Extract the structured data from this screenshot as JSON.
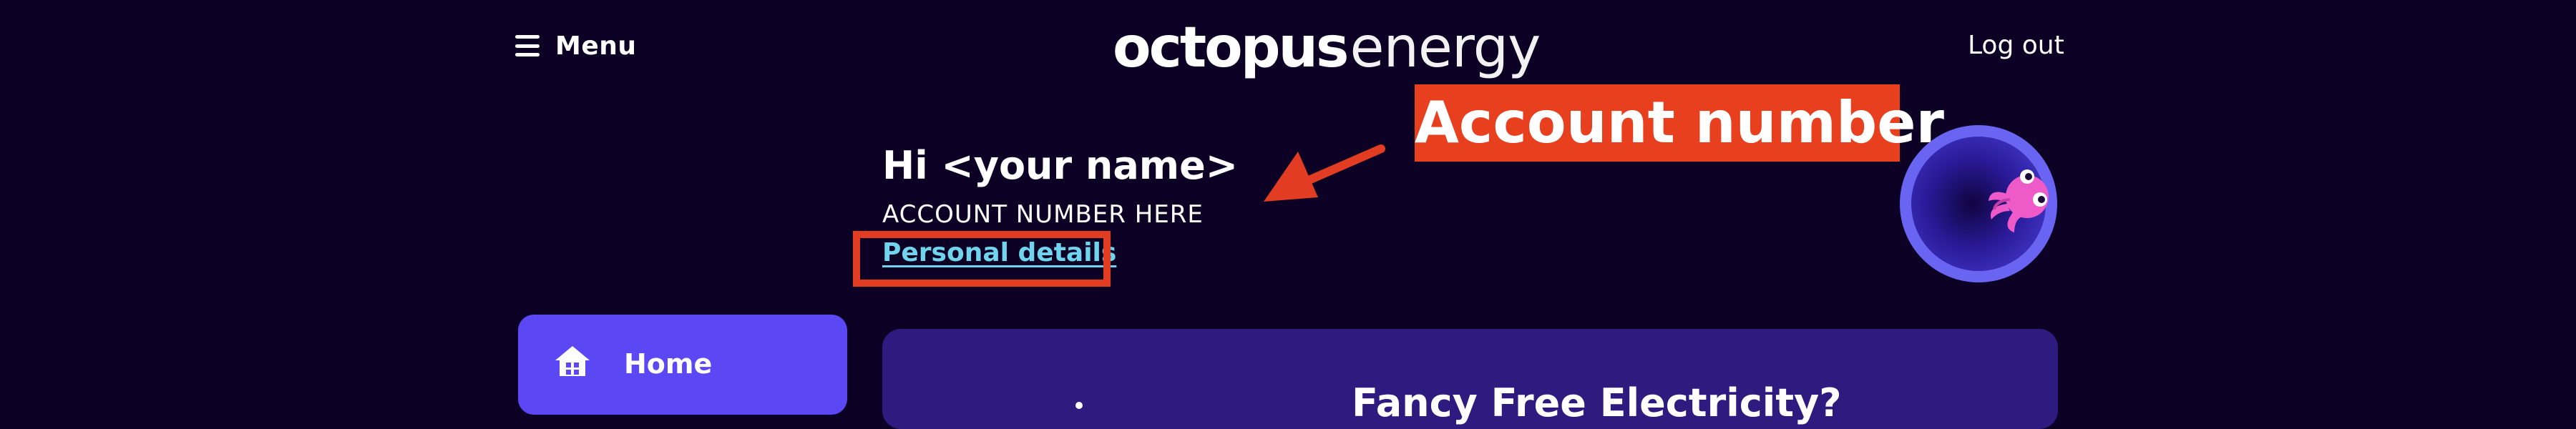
{
  "header": {
    "menu_label": "Menu",
    "logo_primary": "octopus",
    "logo_secondary": "energy",
    "logout_label": "Log out"
  },
  "greeting": {
    "title": "Hi <your name>",
    "account_number": "ACCOUNT NUMBER HERE",
    "personal_details_link": "Personal details"
  },
  "annotation": {
    "callout_text": "Account number",
    "color": "#e8401e"
  },
  "sidebar": {
    "items": [
      {
        "label": "Home",
        "icon": "home-icon",
        "active": true
      }
    ]
  },
  "main": {
    "card_heading": "Fancy Free Electricity?"
  },
  "colors": {
    "background": "#0d0025",
    "link": "#6fd4ec",
    "sidebar_active": "#5b47f3",
    "card": "#2d1b7f",
    "avatar_ring": "#6a64f2",
    "octopus_pink": "#ee5ac8"
  }
}
